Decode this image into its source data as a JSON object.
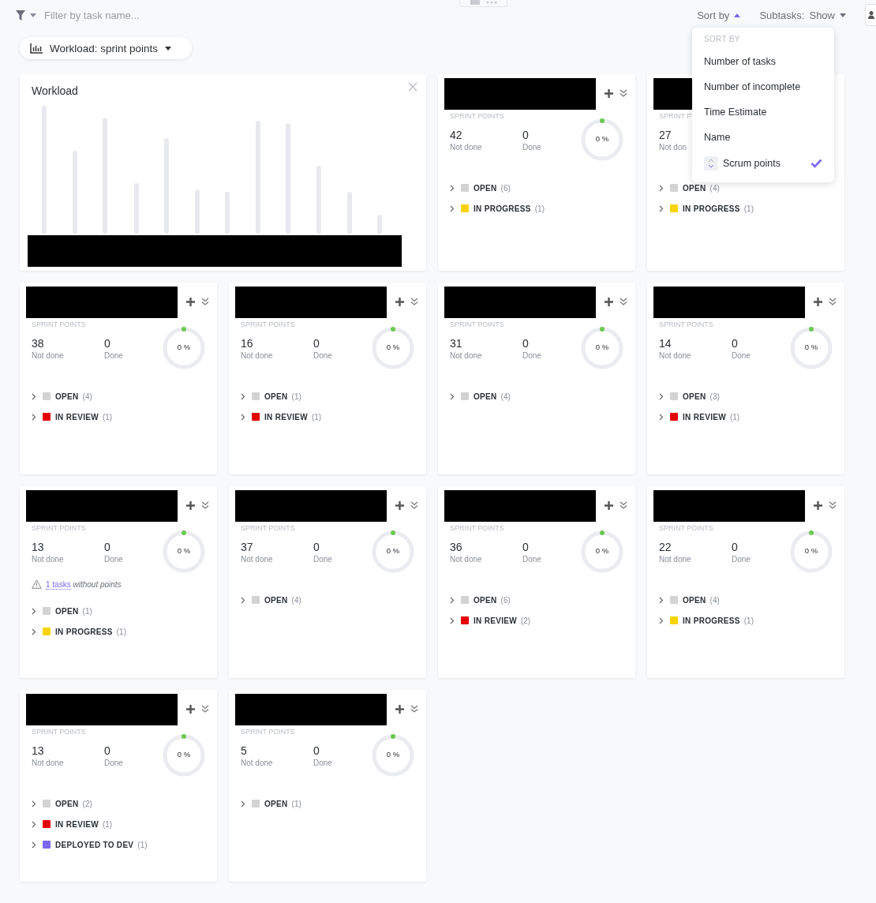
{
  "toolbar": {
    "filter": {
      "placeholder": "Filter by task name..."
    },
    "sort_label": "Sort by",
    "subtasks_label": "Subtasks:",
    "subtasks_value": "Show"
  },
  "view_button": {
    "label": "Workload: sprint points"
  },
  "workload": {
    "title": "Workload"
  },
  "cards": [
    {
      "actions": true,
      "sprint_label": "SPRINT POINTS",
      "not_done": "42",
      "not_done_label": "Not done",
      "done": "0",
      "done_label": "Done",
      "percent": "0 %",
      "statuses": [
        {
          "label": "OPEN",
          "count": "(6)",
          "color": "#d3d3d3"
        },
        {
          "label": "IN PROGRESS",
          "count": "(1)",
          "color": "#f8d406"
        }
      ]
    },
    {
      "actions": false,
      "sprint_label": "SPRINT P",
      "not_done": "27",
      "not_done_label": "Not don",
      "statuses": [
        {
          "label": "OPEN",
          "count": "(4)",
          "color": "#d3d3d3"
        },
        {
          "label": "IN PROGRESS",
          "count": "(1)",
          "color": "#f8d406"
        }
      ]
    },
    {
      "actions": true,
      "sprint_label": "SPRINT POINTS",
      "not_done": "38",
      "not_done_label": "Not done",
      "done": "0",
      "done_label": "Done",
      "percent": "0 %",
      "statuses": [
        {
          "label": "OPEN",
          "count": "(4)",
          "color": "#d3d3d3"
        },
        {
          "label": "IN REVIEW",
          "count": "(1)",
          "color": "#e50000"
        }
      ]
    },
    {
      "actions": true,
      "sprint_label": "SPRINT POINTS",
      "not_done": "16",
      "not_done_label": "Not done",
      "done": "0",
      "done_label": "Done",
      "percent": "0 %",
      "statuses": [
        {
          "label": "OPEN",
          "count": "(1)",
          "color": "#d3d3d3"
        },
        {
          "label": "IN REVIEW",
          "count": "(1)",
          "color": "#e50000"
        }
      ]
    },
    {
      "actions": true,
      "sprint_label": "SPRINT POINTS",
      "not_done": "31",
      "not_done_label": "Not done",
      "done": "0",
      "done_label": "Done",
      "percent": "0 %",
      "statuses": [
        {
          "label": "OPEN",
          "count": "(4)",
          "color": "#d3d3d3"
        }
      ]
    },
    {
      "actions": true,
      "sprint_label": "SPRINT POINTS",
      "not_done": "14",
      "not_done_label": "Not done",
      "done": "0",
      "done_label": "Done",
      "percent": "0 %",
      "statuses": [
        {
          "label": "OPEN",
          "count": "(3)",
          "color": "#d3d3d3"
        },
        {
          "label": "IN REVIEW",
          "count": "(1)",
          "color": "#e50000"
        }
      ]
    },
    {
      "actions": true,
      "sprint_label": "SPRINT POINTS",
      "not_done": "13",
      "not_done_label": "Not done",
      "done": "0",
      "done_label": "Done",
      "percent": "0 %",
      "warning": {
        "link": "1 tasks",
        "text": "without points"
      },
      "statuses": [
        {
          "label": "OPEN",
          "count": "(1)",
          "color": "#d3d3d3"
        },
        {
          "label": "IN PROGRESS",
          "count": "(1)",
          "color": "#f8d406"
        }
      ]
    },
    {
      "actions": true,
      "sprint_label": "SPRINT POINTS",
      "not_done": "37",
      "not_done_label": "Not done",
      "done": "0",
      "done_label": "Done",
      "percent": "0 %",
      "statuses": [
        {
          "label": "OPEN",
          "count": "(4)",
          "color": "#d3d3d3"
        }
      ]
    },
    {
      "actions": true,
      "sprint_label": "SPRINT POINTS",
      "not_done": "36",
      "not_done_label": "Not done",
      "done": "0",
      "done_label": "Done",
      "percent": "0 %",
      "statuses": [
        {
          "label": "OPEN",
          "count": "(6)",
          "color": "#d3d3d3"
        },
        {
          "label": "IN REVIEW",
          "count": "(2)",
          "color": "#e50000"
        }
      ]
    },
    {
      "actions": true,
      "sprint_label": "SPRINT POINTS",
      "not_done": "22",
      "not_done_label": "Not done",
      "done": "0",
      "done_label": "Done",
      "percent": "0 %",
      "statuses": [
        {
          "label": "OPEN",
          "count": "(4)",
          "color": "#d3d3d3"
        },
        {
          "label": "IN PROGRESS",
          "count": "(1)",
          "color": "#f8d406"
        }
      ]
    },
    {
      "actions": true,
      "sprint_label": "SPRINT POINTS",
      "not_done": "13",
      "not_done_label": "Not done",
      "done": "0",
      "done_label": "Done",
      "percent": "0 %",
      "statuses": [
        {
          "label": "OPEN",
          "count": "(2)",
          "color": "#d3d3d3"
        },
        {
          "label": "IN REVIEW",
          "count": "(1)",
          "color": "#e50000"
        },
        {
          "label": "DEPLOYED TO DEV",
          "count": "(1)",
          "color": "#7b68ee"
        }
      ]
    },
    {
      "actions": true,
      "sprint_label": "SPRINT POINTS",
      "not_done": "5",
      "not_done_label": "Not done",
      "done": "0",
      "done_label": "Done",
      "percent": "0 %",
      "statuses": [
        {
          "label": "OPEN",
          "count": "(1)",
          "color": "#d3d3d3"
        }
      ]
    }
  ],
  "sort_menu": {
    "header": "SORT BY",
    "items": [
      {
        "label": "Number of tasks",
        "selected": false
      },
      {
        "label": "Number of incomplete",
        "selected": false
      },
      {
        "label": "Time Estimate",
        "selected": false
      },
      {
        "label": "Name",
        "selected": false
      },
      {
        "label": "Scrum points",
        "selected": true
      }
    ]
  }
}
